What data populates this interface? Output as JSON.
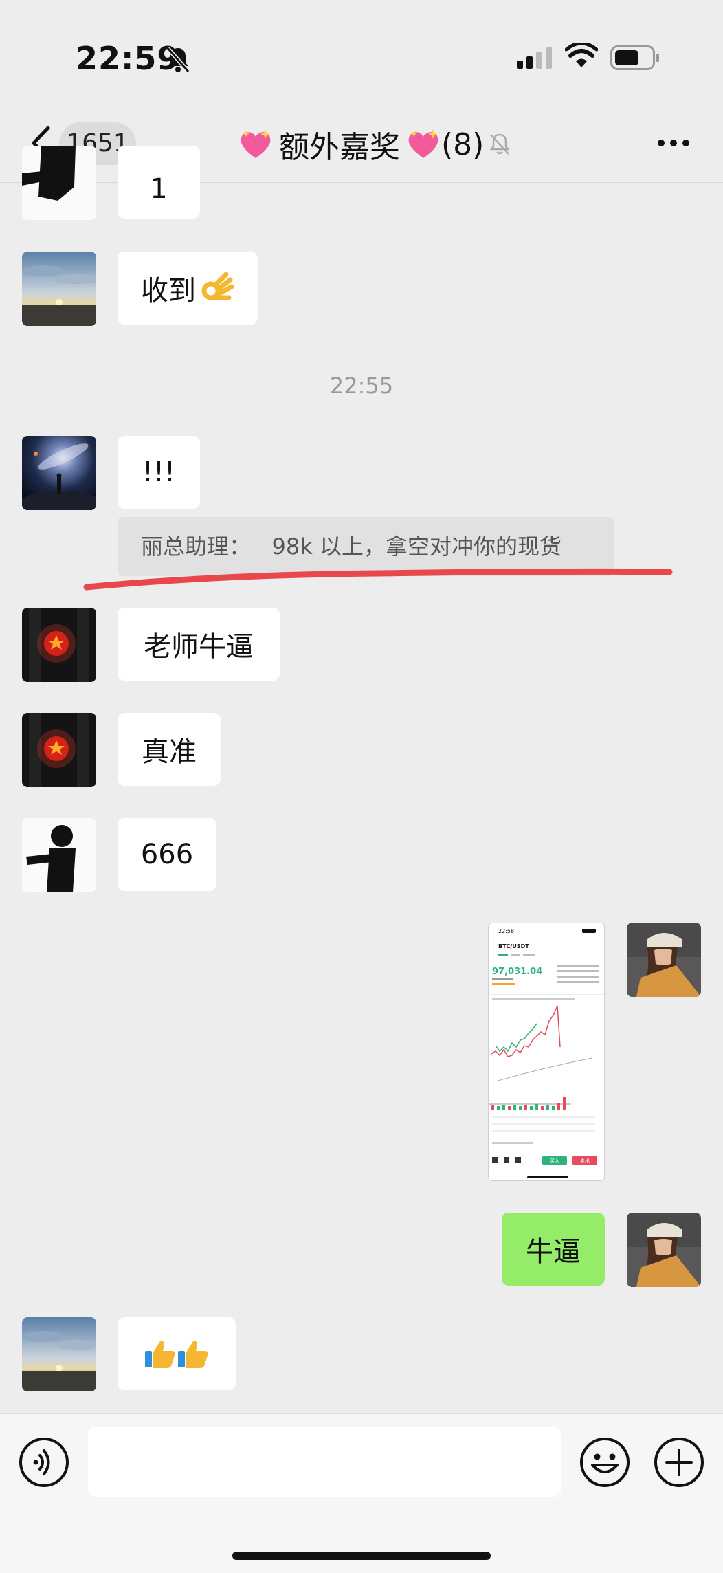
{
  "status_bar": {
    "time": "22:59"
  },
  "nav": {
    "unread_count": "1651",
    "title": "额外嘉奖",
    "member_count": "(8)"
  },
  "messages": [
    {
      "id": 0,
      "sender": "other",
      "text": "1"
    },
    {
      "id": 1,
      "sender": "other",
      "text": "收到"
    },
    {
      "id": 2,
      "type": "time",
      "text": "22:55"
    },
    {
      "id": 3,
      "sender": "other",
      "text": "!!!"
    },
    {
      "id": 4,
      "type": "quote",
      "text": "丽总助理：   98k 以上，拿空对冲你的现货"
    },
    {
      "id": 5,
      "sender": "other",
      "text": "老师牛逼"
    },
    {
      "id": 6,
      "sender": "other",
      "text": "真准"
    },
    {
      "id": 7,
      "sender": "other",
      "text": "666"
    },
    {
      "id": 8,
      "sender": "self",
      "type": "image",
      "image": {
        "time": "22:58",
        "pair": "BTC/USDT",
        "price": "97,031.04",
        "buy_label": "买入",
        "sell_label": "卖出"
      }
    },
    {
      "id": 9,
      "sender": "self",
      "text": "牛逼"
    },
    {
      "id": 10,
      "sender": "other",
      "text": ""
    }
  ],
  "colors": {
    "self_bubble": "#95ec69",
    "other_bubble": "#ffffff",
    "background": "#ededed",
    "annotation_underline": "#e8474c",
    "chart_up": "#2eb37e",
    "chart_down": "#e84a5f"
  },
  "icons": [
    "back-icon",
    "heart-emoji-icon",
    "mute-bell-icon",
    "more-icon",
    "voice-icon",
    "emoji-icon",
    "plus-icon",
    "thumbs-up-icon",
    "ok-hand-icon"
  ]
}
